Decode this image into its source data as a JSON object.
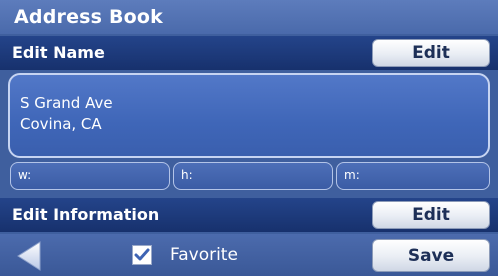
{
  "header": {
    "title": "Address Book"
  },
  "name_section": {
    "label": "Edit Name",
    "edit_label": "Edit"
  },
  "address": {
    "line1": "S Grand Ave",
    "line2": "Covina, CA"
  },
  "phones": {
    "work_label": "w:",
    "home_label": "h:",
    "mobile_label": "m:"
  },
  "info_section": {
    "label": "Edit Information",
    "edit_label": "Edit"
  },
  "footer": {
    "back_icon": "back-arrow-icon",
    "favorite_label": "Favorite",
    "favorite_checked": true,
    "save_label": "Save"
  },
  "colors": {
    "title_bar": "#5d7cbc",
    "section_bar": "#24448a",
    "panel": "#4a70c0",
    "button_text": "#1d2f57"
  }
}
